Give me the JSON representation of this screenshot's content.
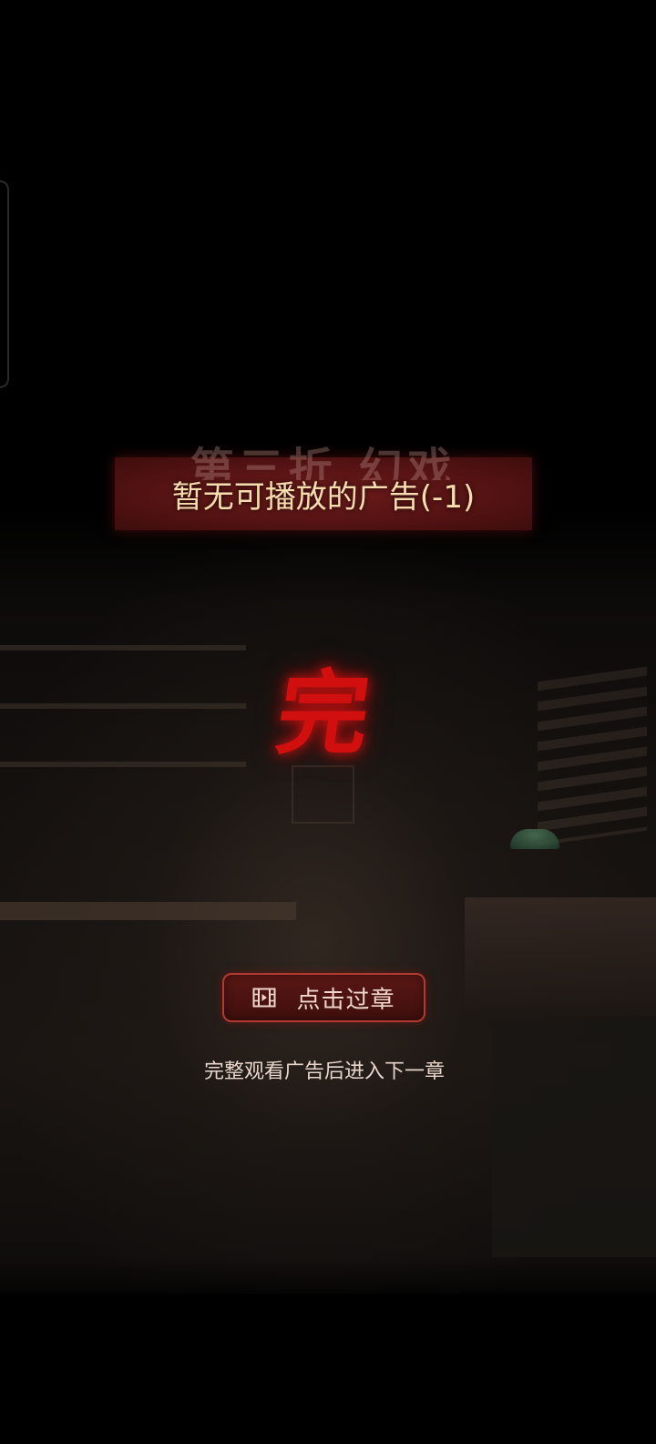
{
  "chapter": {
    "title": "第三折 幻戏",
    "ad_message": "暂无可播放的广告(-1)"
  },
  "finish_mark": "完",
  "skip_button": {
    "icon": "film-icon",
    "label": "点击过章"
  },
  "hint": "完整观看广告后进入下一章",
  "colors": {
    "banner": "#561313",
    "ad_text": "#f6dcae",
    "finish_mark": "#d20f0f",
    "button_border": "#b23a30"
  }
}
